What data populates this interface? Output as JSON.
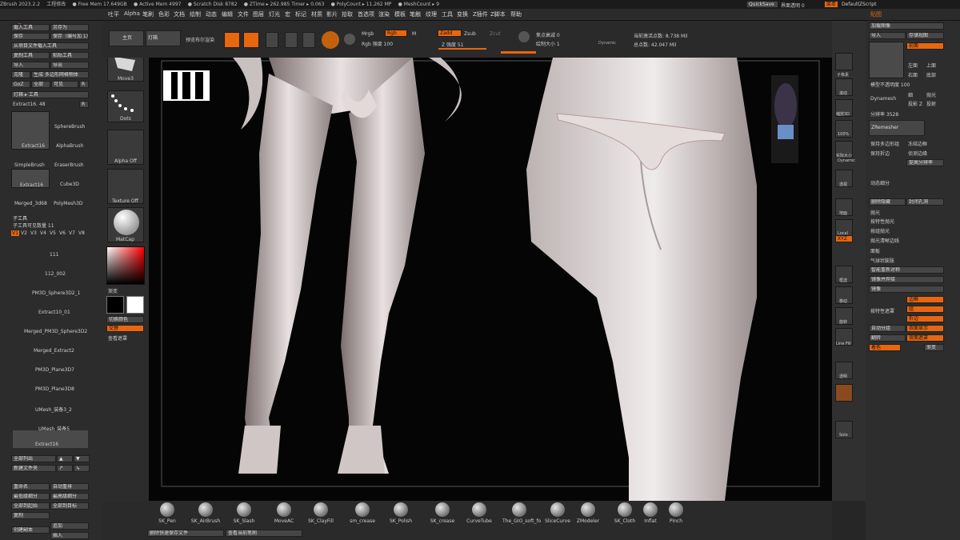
{
  "topbar": {
    "items": [
      "ZBrush 2023.2.2",
      "工程修改",
      "● Free Mem 17.649GB",
      "● Active Mem 4997",
      "● Scratch Disk 8782",
      "● ZTime ▸ 262.985 Timer ▸ 0.063",
      "● PolyCount ▸ 11.262 MP",
      "● MeshCount ▸ 9"
    ],
    "quicksave": "QuickSave",
    "ui_transparency": "界面透明 0",
    "menu": "菜单",
    "script": "DefaultZScript"
  },
  "menubar": [
    "吐平",
    "Alpha",
    "笔刷",
    "色彩",
    "文档",
    "绘制",
    "动态",
    "编辑",
    "文件",
    "图层",
    "灯光",
    "宏",
    "标记",
    "材质",
    "影片",
    "拾取",
    "首选项",
    "渲染",
    "模板",
    "笔触",
    "纹理",
    "工具",
    "变换",
    "Z插件",
    "Z脚本",
    "帮助"
  ],
  "left": {
    "title": "工具",
    "buttons": [
      [
        "载入工具",
        "另存为"
      ],
      [
        "保存",
        "保存（编号加 1）"
      ],
      [
        "从项目文件载入工具"
      ],
      [
        "复制工具",
        "粘贴工具"
      ],
      [
        "导入",
        "导出"
      ],
      [
        "克隆",
        "生成 多边形网格物体"
      ],
      [
        "GoZ",
        "全部",
        "可见",
        "R"
      ],
      [
        "灯箱 ▸ 工具"
      ]
    ],
    "extract_label": "Extract16. 48",
    "tools": [
      "Extract16",
      "SphereBrush",
      "AlphaBrush",
      "SimpleBrush",
      "EraserBrush",
      "Extract16",
      "Cube3D",
      "Merged_3d68",
      "PolyMesh3D"
    ],
    "tool_counts": [
      "16",
      "",
      "",
      "",
      "",
      "16",
      "",
      "",
      ""
    ],
    "subtool_title": "子工具",
    "subtool_count": "子工具可见数量 11",
    "versions": [
      "V1",
      "V2",
      "V3",
      "V4",
      "V5",
      "V6",
      "V7",
      "V8"
    ],
    "subtools": [
      "111",
      "112_002",
      "PM3D_Sphere3D2_1",
      "Extract10_01",
      "Merged_PM3D_Sphere3D2",
      "Merged_Extract2",
      "PM3D_Plane3D7",
      "PM3D_Plane3D8",
      "UMesh_装备3_2",
      "UMesh_装备5",
      "Extract16"
    ],
    "bottom_buttons": [
      [
        "全部列出",
        "▲",
        "▼"
      ],
      [
        "新建文件夹",
        "↱",
        "↳"
      ],
      [
        "重命名",
        "自动重排"
      ],
      [
        "最低级细分",
        "最高级细分"
      ],
      [
        "全部到起始",
        "全部到目标"
      ],
      [
        "复制"
      ],
      [
        "创建副本",
        "追加"
      ],
      [
        "",
        "插入"
      ]
    ]
  },
  "mid": {
    "brush_thumbs": [
      "Move3",
      "Dots",
      "Alpha Off",
      "Texture Off",
      "MatCap"
    ],
    "gradient": "渐变",
    "switch_color": "切换颜色",
    "alternate": "交替",
    "view_mask": "查看遮罩"
  },
  "topctl": {
    "home": "主页",
    "lightbox": "灯箱",
    "preview": "预览布尔渲染",
    "icons": [
      "Edit",
      "绘制",
      "移动",
      "缩放",
      "旋转"
    ],
    "mrgb": "Mrgb",
    "rgb": "Rgb",
    "m": "M",
    "rgb_intensity": "Rgb 强度 100",
    "zadd": "Zadd",
    "zsub": "Zsub",
    "zcut": "Zcut",
    "z_intensity": "Z 强度 51",
    "focal": "焦点衰减 0",
    "draw_size": "绘制大小 1",
    "dynamic": "Dynamic",
    "active_points": "当前激活点数: 8.738 Mil",
    "total_points": "总点数: 42.047 Mil"
  },
  "rightstrip": [
    "子像素",
    "滚动",
    "缩放3D",
    "100%",
    "实际大小",
    "Dynamic",
    "透视",
    "地面",
    "Local",
    "XYZ",
    "框选",
    "移动",
    "旋转",
    "Line Fill",
    "透明",
    "Solo"
  ],
  "rightpanel": {
    "title": "贴图",
    "rows": [
      [
        "加载图像"
      ],
      [
        "导入",
        "存储视图"
      ],
      [
        "前面"
      ],
      [
        "左面",
        "上面"
      ],
      [
        "右面",
        "底部"
      ],
      [
        "模型不透明度 100"
      ],
      [
        "Dynamesh",
        "细",
        "抛光"
      ],
      [
        "投影 Z",
        "投射"
      ],
      [
        "分辨率 3528"
      ],
      [
        "ZRemesher"
      ],
      [
        "保持多边形组",
        "冻结边框"
      ],
      [
        "保持折边",
        "侦测边缘"
      ],
      [
        "",
        "提高分辨率"
      ],
      [
        ""
      ],
      [
        "动态细分"
      ],
      [
        ""
      ],
      [
        "删除隐藏",
        "封闭孔洞"
      ],
      [
        "抛光"
      ],
      [
        "按特性抛光"
      ],
      [
        "按组抛光"
      ],
      [
        "抛光清晰边线"
      ],
      [
        "面板"
      ],
      [
        "气球状膨胀"
      ],
      [
        "智能重新对称"
      ],
      [
        "镜像并焊接"
      ],
      [
        "镜像"
      ],
      [
        "按特性遮罩",
        "边框",
        "组"
      ],
      [
        "",
        "折边"
      ],
      [
        "自动分组",
        "双面显示"
      ],
      [
        "翻转",
        "背面遮罩"
      ],
      [
        "着色",
        "渐变"
      ]
    ]
  },
  "bottom": {
    "brushes": [
      "SK_Pen",
      "SK_AirBrush",
      "SK_Slash",
      "MoveAC",
      "SK_ClayFill",
      "sm_crease",
      "SK_Polish",
      "SK_crease",
      "CurveTube",
      "The_GIO_soft_fo",
      "SliceCurve",
      "ZModeler",
      "SK_Cloth",
      "Inflat",
      "Pinch"
    ],
    "b1": "删除快速保存文件",
    "b2": "查看当前笔刷"
  }
}
